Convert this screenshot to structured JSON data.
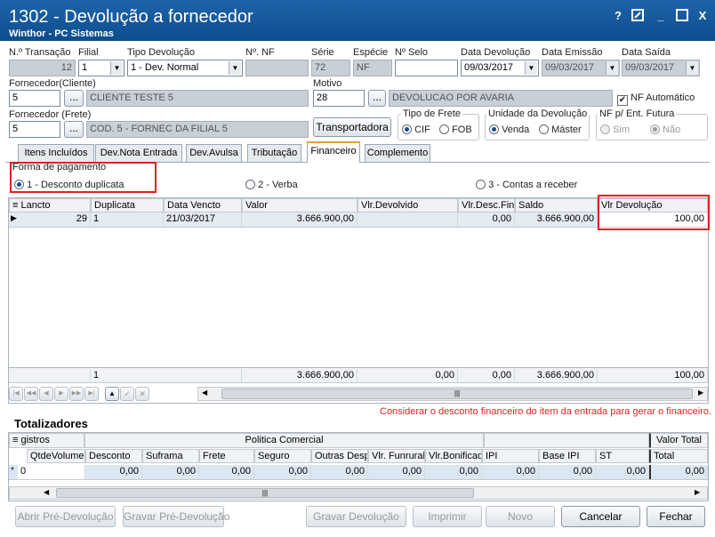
{
  "window": {
    "title": "1302 - Devolução a fornecedor",
    "subtitle": "Winthor - PC Sistemas",
    "help": "?",
    "minimize": "_",
    "close": "X"
  },
  "header": {
    "labels": {
      "transacao": "N.º Transação",
      "filial": "Filial",
      "tipo": "Tipo Devolução",
      "nf": "Nº. NF",
      "serie": "Série",
      "especie": "Espécie",
      "selo": "Nº Selo",
      "data_dev": "Data Devolução",
      "data_emissao": "Data Emissão",
      "data_saida": "Data Saída"
    },
    "values": {
      "transacao": "12",
      "filial": "1",
      "tipo": "1 - Dev. Normal",
      "nf": "",
      "serie": "72",
      "especie": "NF",
      "selo": "",
      "data_dev": "09/03/2017",
      "data_emissao": "09/03/2017",
      "data_saida": "09/03/2017"
    }
  },
  "fornecedor_cliente": {
    "label": "Fornecedor(Cliente)",
    "code": "5",
    "name": "CLIENTE TESTE 5",
    "lookup": "..."
  },
  "motivo": {
    "label": "Motivo",
    "code": "28",
    "desc": "DEVOLUCAO POR AVARIA",
    "lookup": "..."
  },
  "nf_automatico": {
    "label": "NF Automático",
    "mark": "✔"
  },
  "fornecedor_frete": {
    "label": "Fornecedor (Frete)",
    "code": "5",
    "name": "COD. 5 - FORNEC DA FILIAL 5",
    "lookup": "..."
  },
  "transportadora": "Transportadora",
  "frete": {
    "label": "Tipo de Frete",
    "opt1": "CIF",
    "opt2": "FOB"
  },
  "unidade": {
    "label": "Unidade da Devolução",
    "opt1": "Venda",
    "opt2": "Máster"
  },
  "nf_futura": {
    "label": "NF p/ Ent. Futura",
    "opt1": "Sim",
    "opt2": "Não"
  },
  "tabs": [
    "Itens Incluídos",
    "Dev.Nota Entrada",
    "Dev.Avulsa",
    "Tributação",
    "Financeiro",
    "Complemento"
  ],
  "forma": {
    "label": "Forma de pagamento",
    "opt1": "1 - Desconto duplicata",
    "opt2": "2 - Verba",
    "opt3": "3 - Contas a receber"
  },
  "grid": {
    "columns": [
      "Lancto",
      "Duplicata",
      "Data Vencto",
      "Valor",
      "Vlr.Devolvido",
      "Vlr.Desc.Fin",
      "Saldo",
      "Vlr Devolução"
    ],
    "row": [
      "29",
      "1",
      "21/03/2017",
      "3.666.900,00",
      "",
      "0,00",
      "3.666.900,00",
      "100,00"
    ],
    "footer": [
      "",
      "1",
      "",
      "3.666.900,00",
      "0,00",
      "0,00",
      "3.666.900,00",
      "100,00"
    ]
  },
  "nav_buttons": [
    "|◀",
    "◀◀",
    "◀",
    "▶",
    "▶▶",
    "▶|",
    "▲",
    "✓",
    "✕"
  ],
  "hint": "Considerar o desconto financeiro do item da entrada para gerar o financeiro.",
  "totalizadores": {
    "title": "Totalizadores",
    "group_left": "gistros",
    "group_mid": "Politica Comercial",
    "group_right": "Valor Total",
    "columns": [
      "QtdeVolume",
      "Desconto",
      "Suframa",
      "Frete",
      "Seguro",
      "Outras Desp",
      "Vlr. Funrural",
      "Vlr.Bonificad",
      "IPI",
      "Base IPI",
      "ST",
      "Total"
    ],
    "row": [
      "0",
      "0,00",
      "0,00",
      "0,00",
      "0,00",
      "0,00",
      "0,00",
      "0,00",
      "0,00",
      "0,00",
      "0,00",
      "0,00"
    ]
  },
  "footer_buttons": {
    "abrir": "Abrir Pré-Devolução",
    "gravar_pre": "Gravar Pré-Devolução",
    "gravar": "Gravar Devolução",
    "imprimir": "Imprimir",
    "novo": "Novo",
    "cancelar": "Cancelar",
    "fechar": "Fechar"
  }
}
